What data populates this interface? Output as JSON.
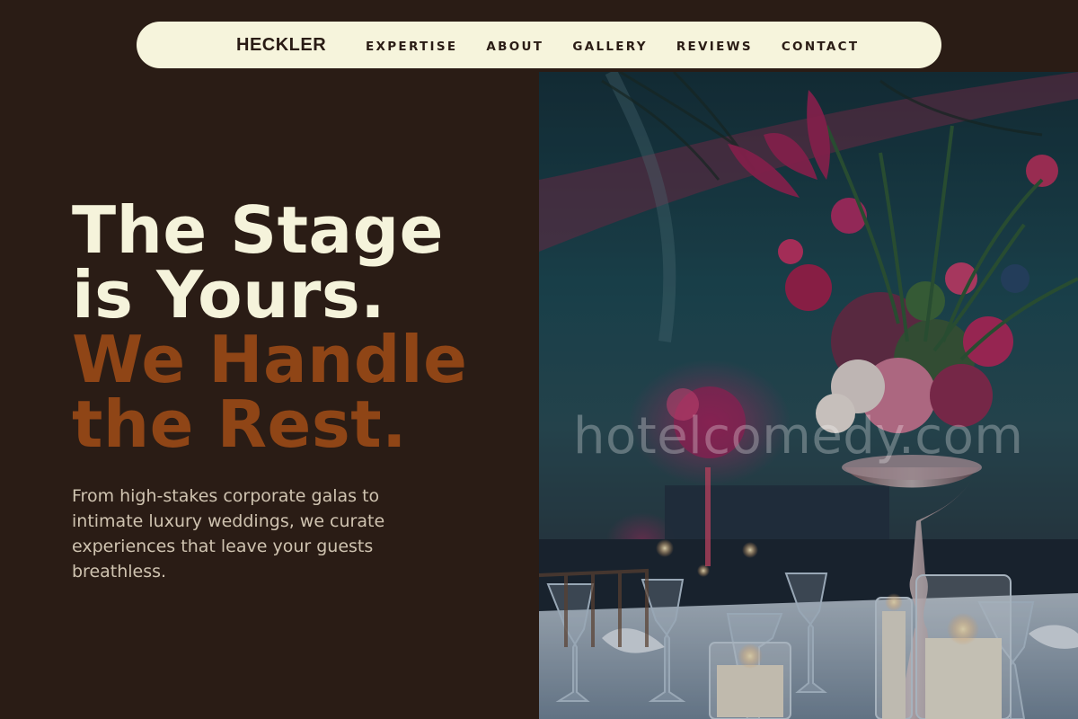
{
  "nav": {
    "brand": "HECKLER",
    "links": [
      "EXPERTISE",
      "ABOUT",
      "GALLERY",
      "REVIEWS",
      "CONTACT"
    ]
  },
  "hero": {
    "headline_light_1": "The Stage",
    "headline_light_2": "is Yours.",
    "headline_accent_1": "We Handle",
    "headline_accent_2": "the Rest.",
    "lead": "From high-stakes corporate galas to intimate luxury weddings, we curate experiences that leave your guests breathless."
  },
  "image": {
    "watermark": "hotelcomedy.com"
  },
  "colors": {
    "background": "#2a1c15",
    "nav_background": "#f6f4dc",
    "headline_light": "#f5f3db",
    "headline_accent": "#8f4516",
    "lead_text": "#cfc3b0"
  }
}
